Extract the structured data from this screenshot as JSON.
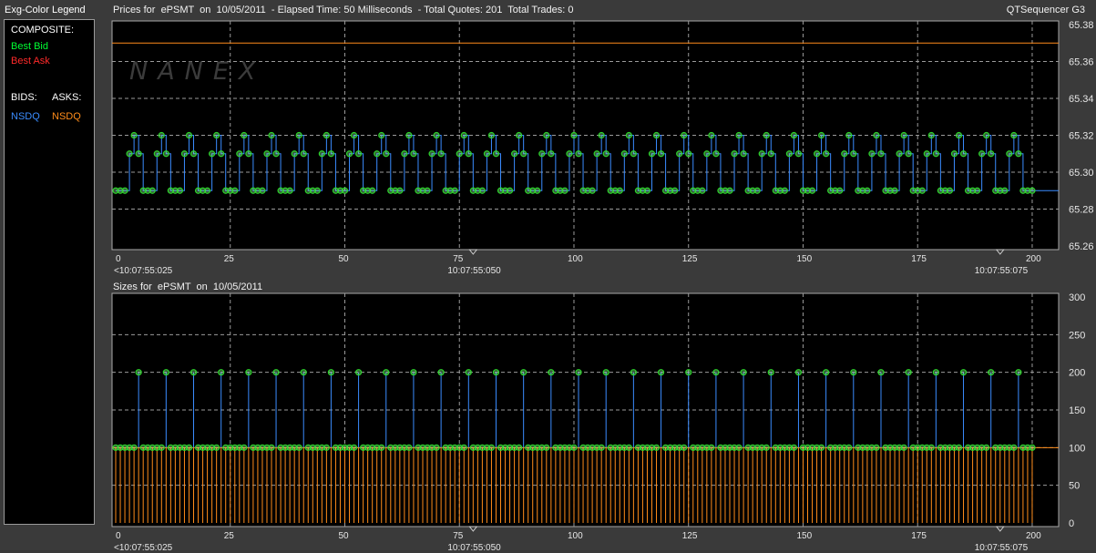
{
  "legend": {
    "title": "Exg-Color Legend",
    "composite_label": "COMPOSITE:",
    "best_bid": "Best Bid",
    "best_ask": "Best Ask",
    "bids_label": "BIDS:",
    "asks_label": "ASKS:",
    "bid_exchange": "NSDQ",
    "ask_exchange": "NSDQ"
  },
  "header": {
    "title": "Prices for  ePSMT  on  10/05/2011  - Elapsed Time: 50 Milliseconds  - Total Quotes: 201  Total Trades: 0",
    "app_name": "QTSequencer G3"
  },
  "sizes_header": "Sizes for  ePSMT  on  10/05/2011",
  "watermark": "NANEX",
  "colors": {
    "best_bid": "#00ff33",
    "best_ask": "#ff2a2a",
    "nsdq_bid": "#3a8cff",
    "nsdq_ask": "#ff8c1a",
    "marker": "#2bd62b",
    "grid": "#9a9a9a"
  },
  "chart_data": [
    {
      "type": "line",
      "title": "Prices for  ePSMT  on  10/05/2011",
      "x_range": [
        0,
        201
      ],
      "x_ticks": [
        0,
        25,
        50,
        75,
        100,
        125,
        150,
        175,
        200
      ],
      "time_labels": [
        "<10:07:55:025",
        "10:07:55:050",
        "10:07:55:075"
      ],
      "time_label_positions": [
        0,
        78,
        193
      ],
      "ylim": [
        65.26,
        65.38
      ],
      "y_ticks": [
        "65.26",
        "65.28",
        "65.30",
        "65.32",
        "65.34",
        "65.36",
        "65.38"
      ],
      "grid": true,
      "series": [
        {
          "name": "NSDQ",
          "role": "ask",
          "constant": 65.37
        },
        {
          "name": "NSDQ",
          "role": "bid",
          "levels": [
            65.29,
            65.31,
            65.32
          ],
          "pattern": [
            65.29,
            65.29,
            65.29,
            65.31,
            65.32,
            65.31
          ]
        }
      ]
    },
    {
      "type": "bar",
      "title": "Sizes for  ePSMT  on  10/05/2011",
      "x_range": [
        0,
        201
      ],
      "x_ticks": [
        0,
        25,
        50,
        75,
        100,
        125,
        150,
        175,
        200
      ],
      "time_labels": [
        "<10:07:55:025",
        "10:07:55:050",
        "10:07:55:075"
      ],
      "time_label_positions": [
        0,
        78,
        193
      ],
      "ylim": [
        0,
        300
      ],
      "y_ticks": [
        "0",
        "50",
        "100",
        "150",
        "200",
        "250",
        "300"
      ],
      "grid": true,
      "series": [
        {
          "name": "NSDQ",
          "role": "ask_size",
          "constant": 100
        },
        {
          "name": "NSDQ",
          "role": "bid_size",
          "pattern": [
            100,
            100,
            100,
            100,
            100,
            200
          ],
          "spike_value": 200,
          "base_value": 100
        }
      ]
    }
  ]
}
